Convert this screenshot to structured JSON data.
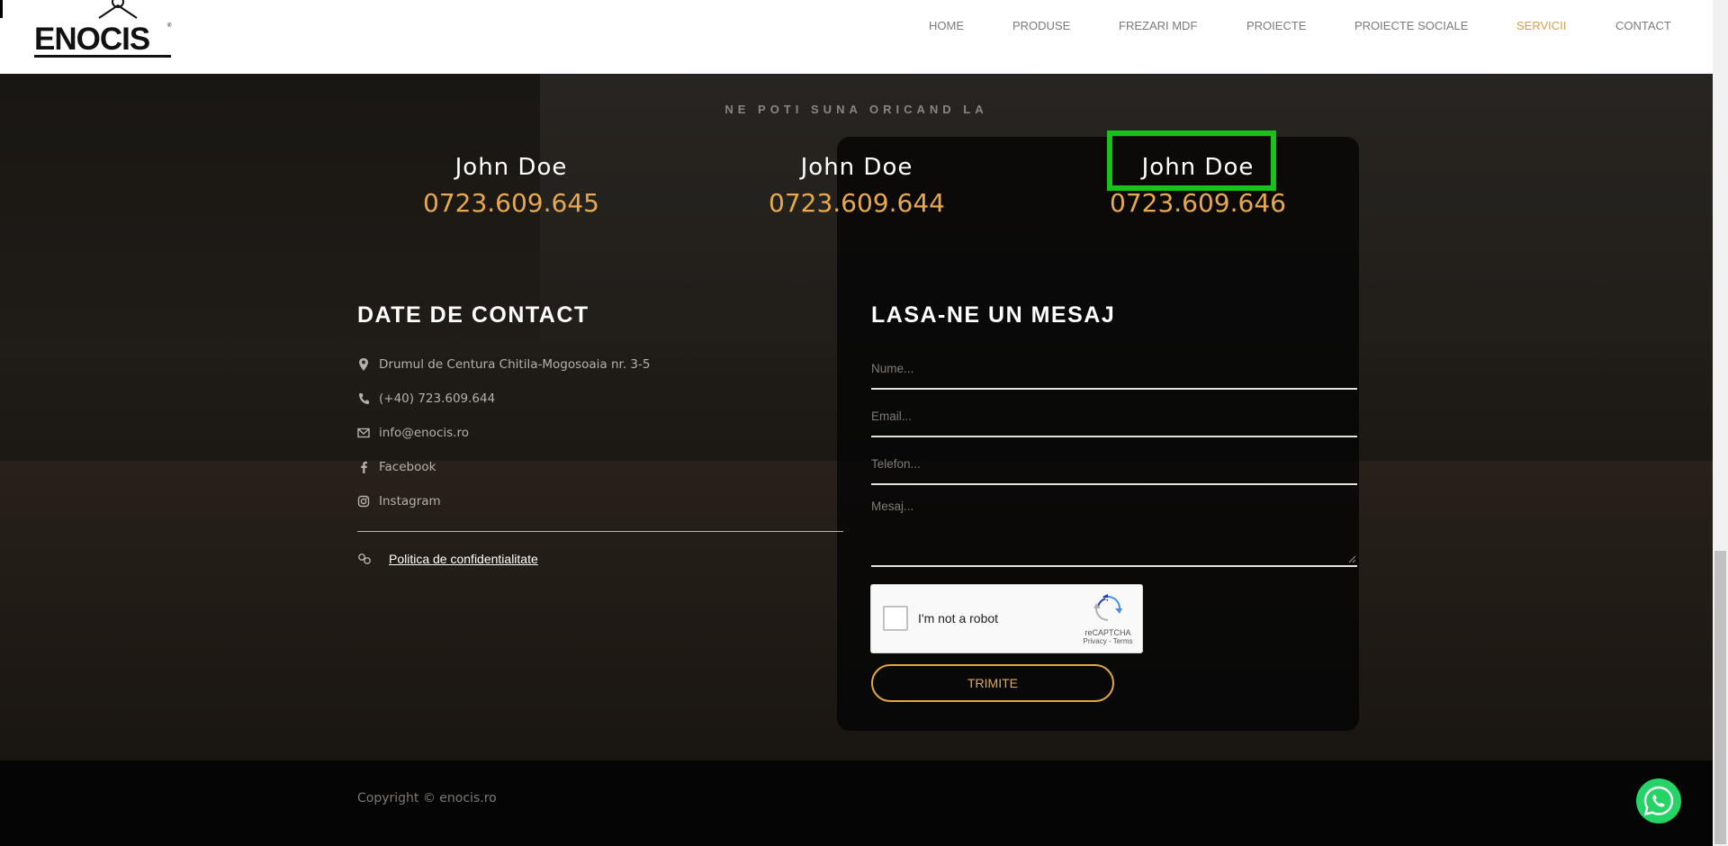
{
  "header": {
    "logo_text": "ENOCIS",
    "logo_reg": "®",
    "nav": [
      {
        "label": "HOME",
        "active": false
      },
      {
        "label": "PRODUSE",
        "active": false
      },
      {
        "label": "FREZARI MDF",
        "active": false
      },
      {
        "label": "PROIECTE",
        "active": false
      },
      {
        "label": "PROIECTE SOCIALE",
        "active": false
      },
      {
        "label": "SERVICII",
        "active": true
      },
      {
        "label": "CONTACT",
        "active": false
      }
    ]
  },
  "call": {
    "title": "NE POTI SUNA ORICAND LA",
    "people": [
      {
        "name": "John Doe",
        "phone": "0723.609.645"
      },
      {
        "name": "John Doe",
        "phone": "0723.609.644"
      },
      {
        "name": "John Doe",
        "phone": "0723.609.646"
      }
    ]
  },
  "contact": {
    "title": "DATE DE CONTACT",
    "items": [
      {
        "icon": "map-pin-icon",
        "text": "Drumul de Centura Chitila-Mogosoaia nr. 3-5"
      },
      {
        "icon": "phone-icon",
        "text": "(+40) 723.609.644"
      },
      {
        "icon": "envelope-icon",
        "text": "info@enocis.ro"
      },
      {
        "icon": "facebook-icon",
        "text": "Facebook"
      },
      {
        "icon": "instagram-icon",
        "text": "Instagram"
      }
    ],
    "policy": "Politica de confidentialitate"
  },
  "form": {
    "title": "LASA-NE UN MESAJ",
    "fields": {
      "name": "Nume...",
      "email": "Email...",
      "phone": "Telefon...",
      "message": "Mesaj..."
    },
    "captcha": {
      "label": "I'm not a robot",
      "brand": "reCAPTCHA",
      "links": "Privacy - Terms"
    },
    "submit": "TRIMITE"
  },
  "footer": {
    "copyright": "Copyright © enocis.ro"
  },
  "colors": {
    "accent": "#e8a84e",
    "nav_active": "#d4a24c",
    "highlight": "#17c21c",
    "whatsapp": "#25d366"
  }
}
